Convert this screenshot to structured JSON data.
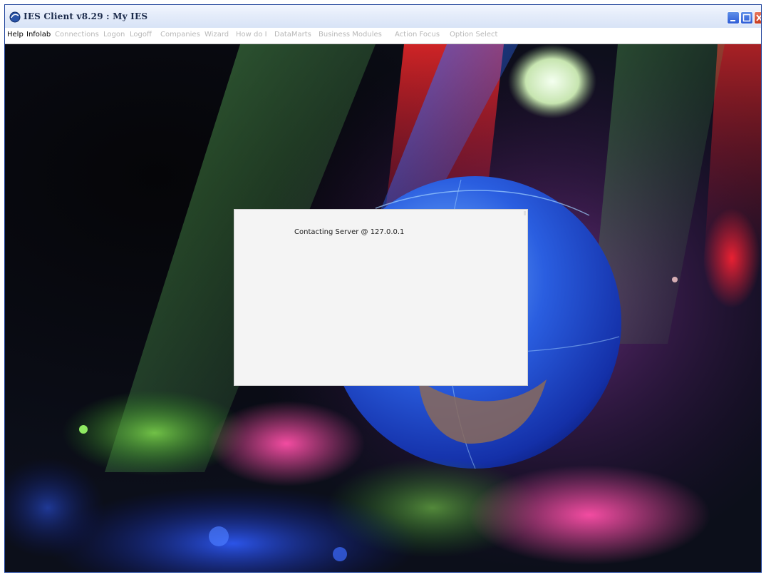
{
  "window": {
    "title": "IES Client v8.29 : My IES"
  },
  "menu": {
    "items": [
      {
        "label": "Help",
        "enabled": true
      },
      {
        "label": "Infolab",
        "enabled": true
      },
      {
        "label": "Connections",
        "enabled": false
      },
      {
        "label": "Logon",
        "enabled": false
      },
      {
        "label": "Logoff",
        "enabled": false
      },
      {
        "label": "Companies",
        "enabled": false
      },
      {
        "label": "Wizard",
        "enabled": false
      },
      {
        "label": "How do I",
        "enabled": false
      },
      {
        "label": "DataMarts",
        "enabled": false
      },
      {
        "label": "Business Modules",
        "enabled": false
      },
      {
        "label": "Action Focus",
        "enabled": false
      },
      {
        "label": "Option Select",
        "enabled": false
      }
    ]
  },
  "dialog": {
    "message": "Contacting Server @ 127.0.0.1"
  },
  "colors": {
    "title_bar": "#dfe8f8",
    "menu_enabled": "#000000",
    "menu_disabled": "#b8b8b8",
    "dialog_bg": "#f4f4f4"
  }
}
